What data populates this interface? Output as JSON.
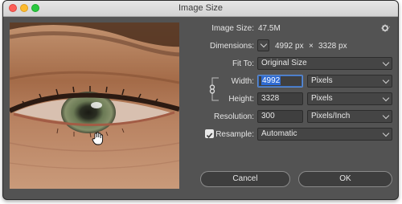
{
  "window": {
    "title": "Image Size"
  },
  "info": {
    "image_size_label": "Image Size:",
    "image_size_value": "47.5M",
    "dimensions_label": "Dimensions:",
    "dimensions_width": "4992 px",
    "dimensions_x": "×",
    "dimensions_height": "3328 px"
  },
  "fit_to": {
    "label": "Fit To:",
    "value": "Original Size"
  },
  "width": {
    "label": "Width:",
    "value": "4992",
    "unit": "Pixels"
  },
  "height": {
    "label": "Height:",
    "value": "3328",
    "unit": "Pixels"
  },
  "resolution": {
    "label": "Resolution:",
    "value": "300",
    "unit": "Pixels/Inch"
  },
  "resample": {
    "label": "Resample:",
    "checked": true,
    "value": "Automatic"
  },
  "buttons": {
    "cancel": "Cancel",
    "ok": "OK"
  },
  "icons": {
    "settings": "gear-icon",
    "constrain": "chain-link-icon",
    "cursor": "hand-cursor-icon"
  },
  "colors": {
    "dialog_bg": "#535353",
    "field_bg": "#3f3f3f",
    "selection": "#2f6bd3",
    "text": "#e4e4e4"
  }
}
